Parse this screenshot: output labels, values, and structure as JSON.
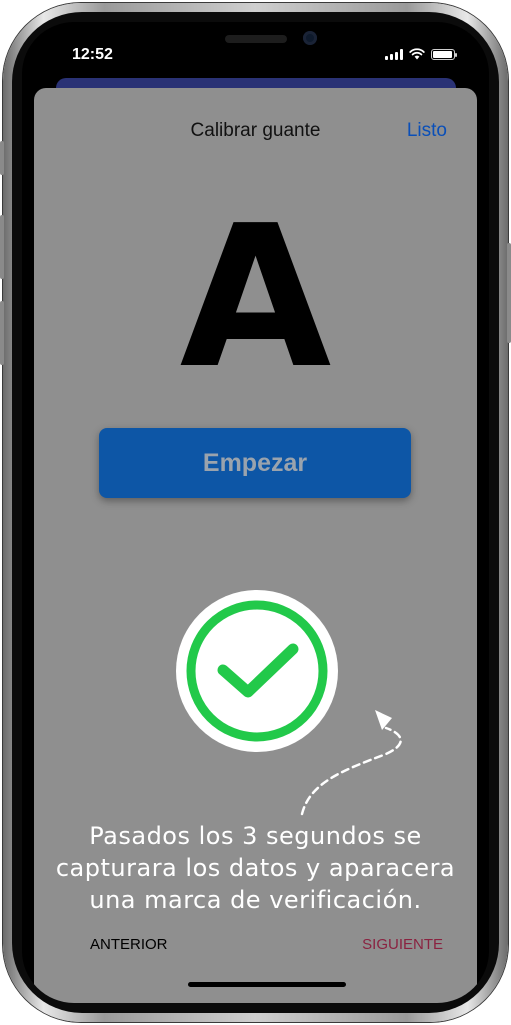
{
  "status_bar": {
    "time": "12:52",
    "icons": [
      "signal-icon",
      "wifi-icon",
      "battery-icon"
    ]
  },
  "header": {
    "title": "Calibrar guante",
    "done_label": "Listo"
  },
  "main": {
    "letter": "A",
    "start_button_label": "Empezar",
    "check_icon": "checkmark-circle-icon",
    "hint": "Pasados los 3 segundos se capturara los datos y aparacera una marca de verificación."
  },
  "footer": {
    "previous_label": "ANTERIOR",
    "next_label": "SIGUIENTE"
  },
  "colors": {
    "sheet_background": "#8f8f8f",
    "accent_blue": "#0d56a6",
    "link_blue": "#0a4fb8",
    "check_green": "#22c94a",
    "next_red": "#8a2240"
  }
}
